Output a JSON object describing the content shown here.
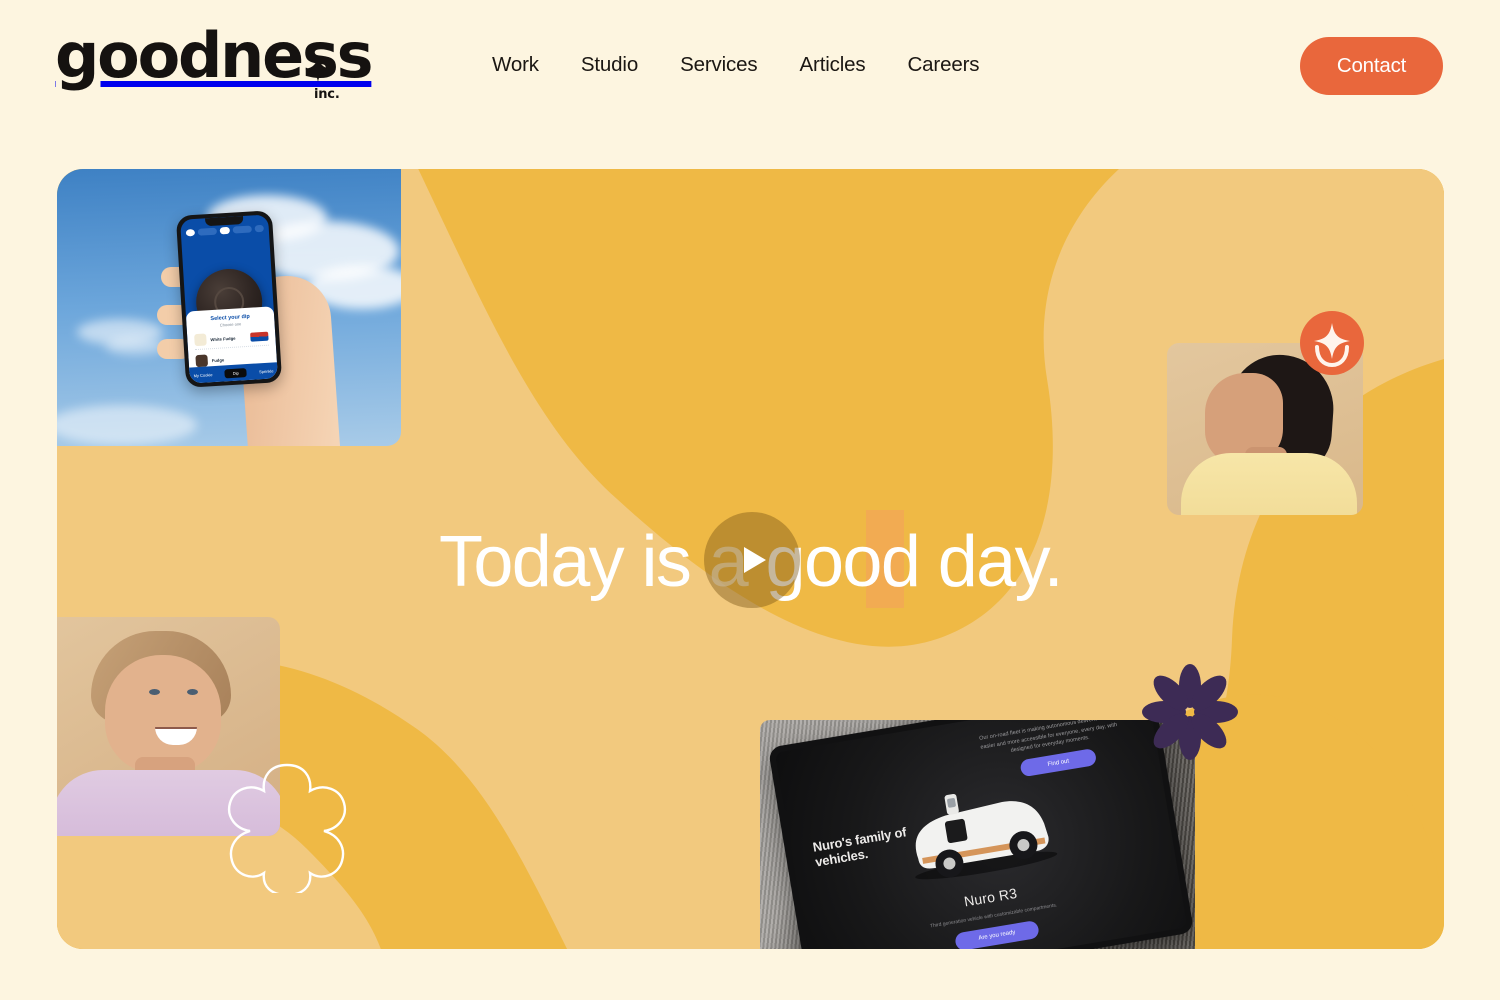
{
  "site": {
    "background_color": "#FDF5E0",
    "accent_color": "#E9673C",
    "hero_color": "#EFB945",
    "hero_swoosh_color": "#F2C97E"
  },
  "header": {
    "logo": {
      "word": "goodness",
      "suffix": "inc.",
      "star_icon": "sparkle-icon"
    },
    "nav": [
      {
        "label": "Work"
      },
      {
        "label": "Studio"
      },
      {
        "label": "Services"
      },
      {
        "label": "Articles"
      },
      {
        "label": "Careers"
      }
    ],
    "contact_button": {
      "label": "Contact"
    }
  },
  "hero": {
    "headline_parts": {
      "before": "Today is ",
      "highlight": "a",
      "after": " good day."
    },
    "headline_full": "Today is a good day.",
    "play_button": {
      "icon": "play-icon",
      "label": "Play showreel"
    },
    "media": {
      "phone_card": {
        "name": "oreo-app-phone-photo",
        "screen": {
          "sheet_title": "Select your dip",
          "sheet_subtitle": "Choose one",
          "options": [
            {
              "label": "White Fudge"
            },
            {
              "label": "Fudge"
            }
          ],
          "tab_left": "My Cookie",
          "tab_middle": "Dip",
          "tab_right": "Sprinkle"
        }
      },
      "portrait_right": {
        "name": "team-portrait-right"
      },
      "portrait_left": {
        "name": "team-portrait-left"
      },
      "tablet_card": {
        "name": "nuro-website-tablet-photo",
        "screen": {
          "heading": "Nuro's family of vehicles.",
          "paragraph": "Our on-road fleet is making autonomous deliveries safer, easier and more accessible for everyone, every day, with designed for everyday moments.",
          "top_button": "Find out",
          "model": "Nuro R3",
          "model_caption": "Third generation vehicle with customizable compartments.",
          "bottom_button": "Are you ready"
        }
      }
    },
    "decorations": {
      "smile_badge": {
        "name": "sparkle-smile-badge",
        "color": "#E9673C"
      },
      "purple_flower": {
        "name": "purple-flower-icon",
        "color": "#3D2B55"
      },
      "outline_flower": {
        "name": "outline-flower-icon",
        "color": "#FFFFFF"
      },
      "peach_block": {
        "name": "peach-accent-block",
        "color": "#F4A05C"
      }
    }
  }
}
